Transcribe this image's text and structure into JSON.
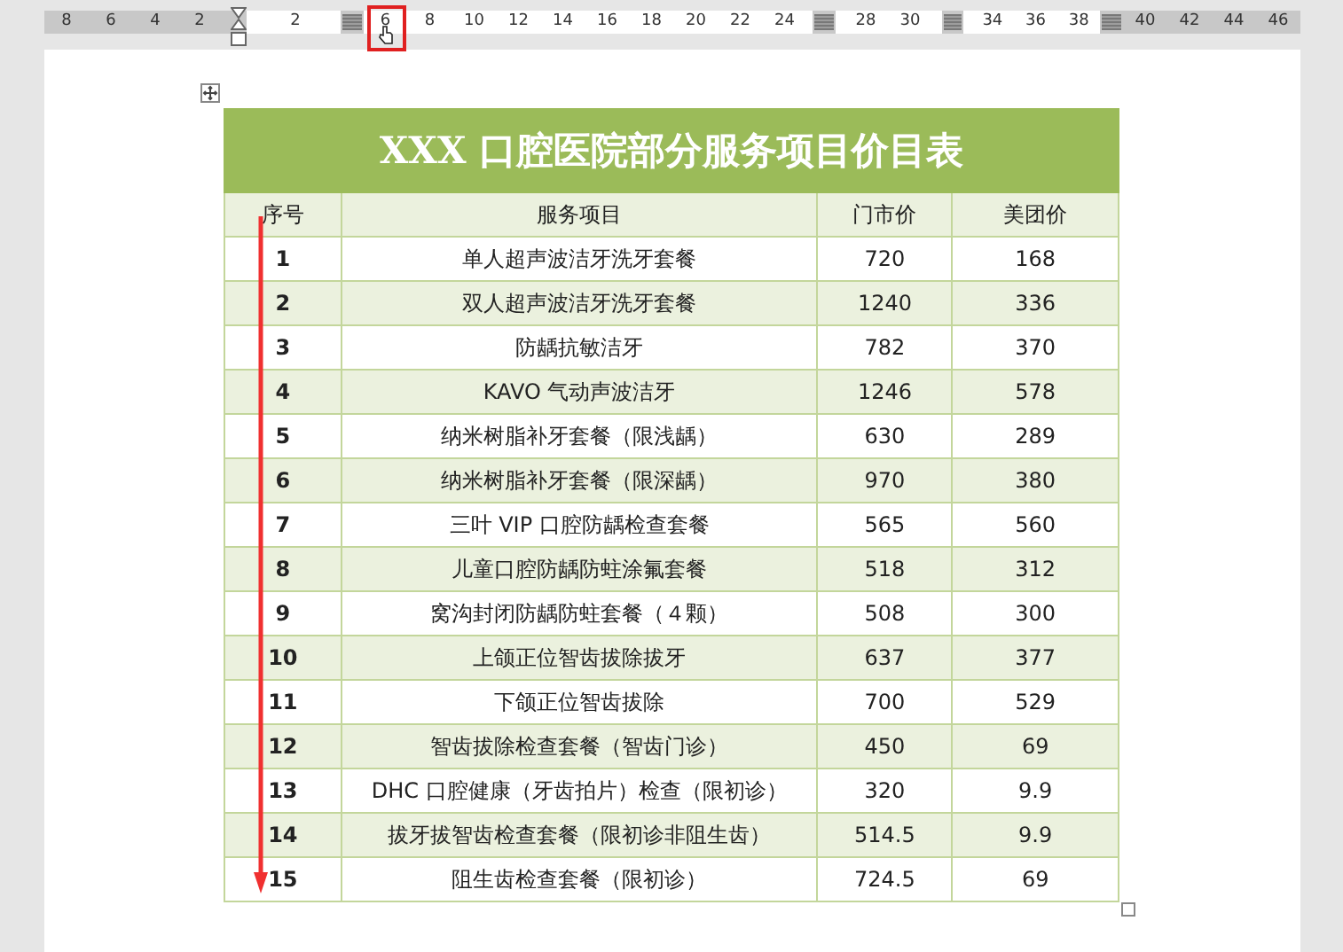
{
  "ruler": {
    "segments": [
      {
        "kind": "margin",
        "labels": [
          {
            "text": "8"
          },
          {
            "text": "6"
          },
          {
            "text": "4"
          },
          {
            "text": "2"
          }
        ]
      },
      {
        "kind": "indent"
      },
      {
        "kind": "text",
        "labels": [
          {
            "text": "2"
          }
        ]
      },
      {
        "kind": "marker"
      },
      {
        "kind": "text",
        "labels": [
          {
            "text": "6",
            "highlighted": true
          },
          {
            "text": "8"
          },
          {
            "text": "10"
          },
          {
            "text": "12"
          },
          {
            "text": "14"
          },
          {
            "text": "16"
          },
          {
            "text": "18"
          },
          {
            "text": "20"
          },
          {
            "text": "22"
          },
          {
            "text": "24"
          }
        ]
      },
      {
        "kind": "marker"
      },
      {
        "kind": "text",
        "labels": [
          {
            "text": "28"
          },
          {
            "text": "30"
          }
        ]
      },
      {
        "kind": "marker"
      },
      {
        "kind": "text",
        "labels": [
          {
            "text": "34"
          },
          {
            "text": "36"
          },
          {
            "text": "38"
          }
        ]
      },
      {
        "kind": "marker"
      },
      {
        "kind": "margin",
        "labels": [
          {
            "text": "40"
          },
          {
            "text": "42"
          },
          {
            "text": "44"
          },
          {
            "text": "46"
          }
        ]
      }
    ]
  },
  "table": {
    "title": "XXX 口腔医院部分服务项目价目表",
    "columns": [
      "序号",
      "服务项目",
      "门市价",
      "美团价"
    ],
    "rows": [
      [
        "1",
        "单人超声波洁牙洗牙套餐",
        "720",
        "168"
      ],
      [
        "2",
        "双人超声波洁牙洗牙套餐",
        "1240",
        "336"
      ],
      [
        "3",
        "防龋抗敏洁牙",
        "782",
        "370"
      ],
      [
        "4",
        "KAVO 气动声波洁牙",
        "1246",
        "578"
      ],
      [
        "5",
        "纳米树脂补牙套餐（限浅龋）",
        "630",
        "289"
      ],
      [
        "6",
        "纳米树脂补牙套餐（限深龋）",
        "970",
        "380"
      ],
      [
        "7",
        "三叶 VIP 口腔防龋检查套餐",
        "565",
        "560"
      ],
      [
        "8",
        "儿童口腔防龋防蛀涂氟套餐",
        "518",
        "312"
      ],
      [
        "9",
        "窝沟封闭防龋防蛀套餐（４颗）",
        "508",
        "300"
      ],
      [
        "10",
        "上颌正位智齿拔除拔牙",
        "637",
        "377"
      ],
      [
        "11",
        "下颌正位智齿拔除",
        "700",
        "529"
      ],
      [
        "12",
        "智齿拔除检查套餐（智齿门诊）",
        "450",
        "69"
      ],
      [
        "13",
        "DHC 口腔健康（牙齿拍片）检查（限初诊）",
        "320",
        "9.9"
      ],
      [
        "14",
        "拔牙拔智齿检查套餐（限初诊非阻生齿）",
        "514.5",
        "9.9"
      ],
      [
        "15",
        "阻生齿检查套餐（限初诊）",
        "724.5",
        "69"
      ]
    ]
  }
}
